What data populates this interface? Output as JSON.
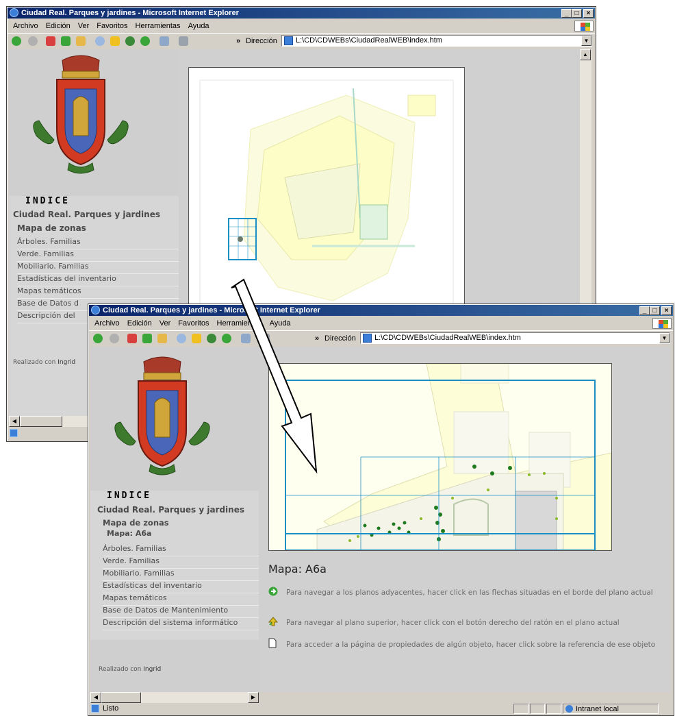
{
  "window_back": {
    "title": "Ciudad Real. Parques y jardines - Microsoft Internet Explorer",
    "menu": [
      "Archivo",
      "Edición",
      "Ver",
      "Favoritos",
      "Herramientas",
      "Ayuda"
    ],
    "address_label": "Dirección",
    "address": "L:\\CD\\CDWEBs\\CiudadRealWEB\\index.htm",
    "toolbar_chevron": "»",
    "window_buttons": {
      "minimize": "_",
      "maximize": "□",
      "close": "×"
    },
    "sidebar": {
      "index_title": "INDICE",
      "site_title": "Ciudad Real. Parques y jardines",
      "section": "Mapa de zonas",
      "items": [
        "Árboles. Familias",
        "Verde. Familias",
        "Mobiliario. Familias",
        "Estadísticas del inventario",
        "Mapas temáticos",
        "Base de Datos d",
        "Descripción del"
      ],
      "credit_prefix": "Realizado con",
      "credit_name": "Ingrid"
    }
  },
  "window_front": {
    "title": "Ciudad Real. Parques y jardines - Microsoft Internet Explorer",
    "menu": [
      "Archivo",
      "Edición",
      "Ver",
      "Favoritos",
      "Herramientas",
      "Ayuda"
    ],
    "address_label": "Dirección",
    "address": "L:\\CD\\CDWEBs\\CiudadRealWEB\\index.htm",
    "toolbar_chevron": "»",
    "window_buttons": {
      "minimize": "_",
      "maximize": "□",
      "close": "×"
    },
    "sidebar": {
      "index_title": "INDICE",
      "site_title": "Ciudad Real. Parques y jardines",
      "section": "Mapa de zonas",
      "subsection": "Mapa: A6a",
      "items": [
        "Árboles. Familias",
        "Verde. Familias",
        "Mobiliario. Familias",
        "Estadísticas del inventario",
        "Mapas temáticos",
        "Base de Datos de Mantenimiento",
        "Descripción del sistema informático"
      ],
      "credit_prefix": "Realizado con",
      "credit_name": "Ingrid"
    },
    "content": {
      "map_title": "Mapa: A6a",
      "tips": [
        {
          "icon": "green-arrow-icon",
          "text": "Para navegar a los planos adyacentes, hacer click en las flechas situadas en el borde del plano actual"
        },
        {
          "icon": "up-arrow-icon",
          "text": "Para navegar al plano superior, hacer click con el botón derecho del ratón en el plano actual"
        },
        {
          "icon": "page-icon",
          "text": "Para acceder a la página de propiedades de algún objeto, hacer click sobre la referencia de ese objeto"
        }
      ]
    },
    "status": {
      "text": "Listo",
      "zone": "Intranet local"
    }
  },
  "colors": {
    "title_start": "#0a246a",
    "title_end": "#3a6ea5",
    "sidebar_bg": "#cfcfcf",
    "map_grid": "#1a8fc4"
  }
}
